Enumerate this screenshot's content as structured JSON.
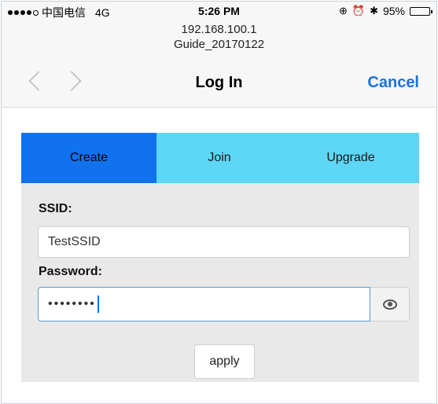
{
  "status_bar": {
    "carrier": "中国电信",
    "network": "4G",
    "time": "5:26 PM",
    "battery_percent": "95%",
    "battery_level": 0.95
  },
  "nav": {
    "host": "192.168.100.1",
    "page_name": "Guide_20170122",
    "title": "Log In",
    "cancel_label": "Cancel"
  },
  "tabs": [
    {
      "label": "Create",
      "active": true
    },
    {
      "label": "Join",
      "active": false
    },
    {
      "label": "Upgrade",
      "active": false
    }
  ],
  "form": {
    "ssid_label": "SSID:",
    "ssid_value": "TestSSID",
    "password_label": "Password:",
    "password_masked": "••••••••",
    "apply_label": "apply"
  },
  "colors": {
    "accent": "#1a73d9",
    "tab_active": "#1172ee",
    "tab_bg": "#5dd7f5",
    "panel_bg": "#e9e9e9"
  },
  "icons": [
    "back-chevron-icon",
    "forward-chevron-icon",
    "eye-icon",
    "alarm-icon",
    "bluetooth-icon",
    "battery-icon"
  ]
}
